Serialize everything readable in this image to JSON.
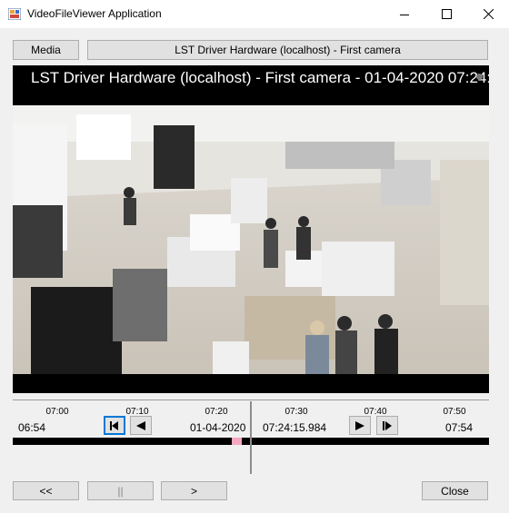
{
  "window": {
    "title": "VideoFileViewer Application"
  },
  "toolbar": {
    "media_label": "Media",
    "camera_label": "LST Driver Hardware (localhost) - First camera"
  },
  "video": {
    "overlay_text": "LST Driver Hardware (localhost) - First camera - 01-04-2020 07:24:1..."
  },
  "timeline": {
    "ticks": [
      "07:00",
      "07:10",
      "07:20",
      "07:30",
      "07:40",
      "07:50"
    ],
    "start_time": "06:54",
    "date": "01-04-2020",
    "current_time": "07:24:15.984",
    "end_time": "07:54"
  },
  "footer": {
    "rewind_label": "<<",
    "pause_label": "||",
    "play_label": ">",
    "close_label": "Close"
  },
  "colors": {
    "accent": "#0078d7",
    "marker": "#f4a8c0",
    "video_bg": "#000000"
  }
}
